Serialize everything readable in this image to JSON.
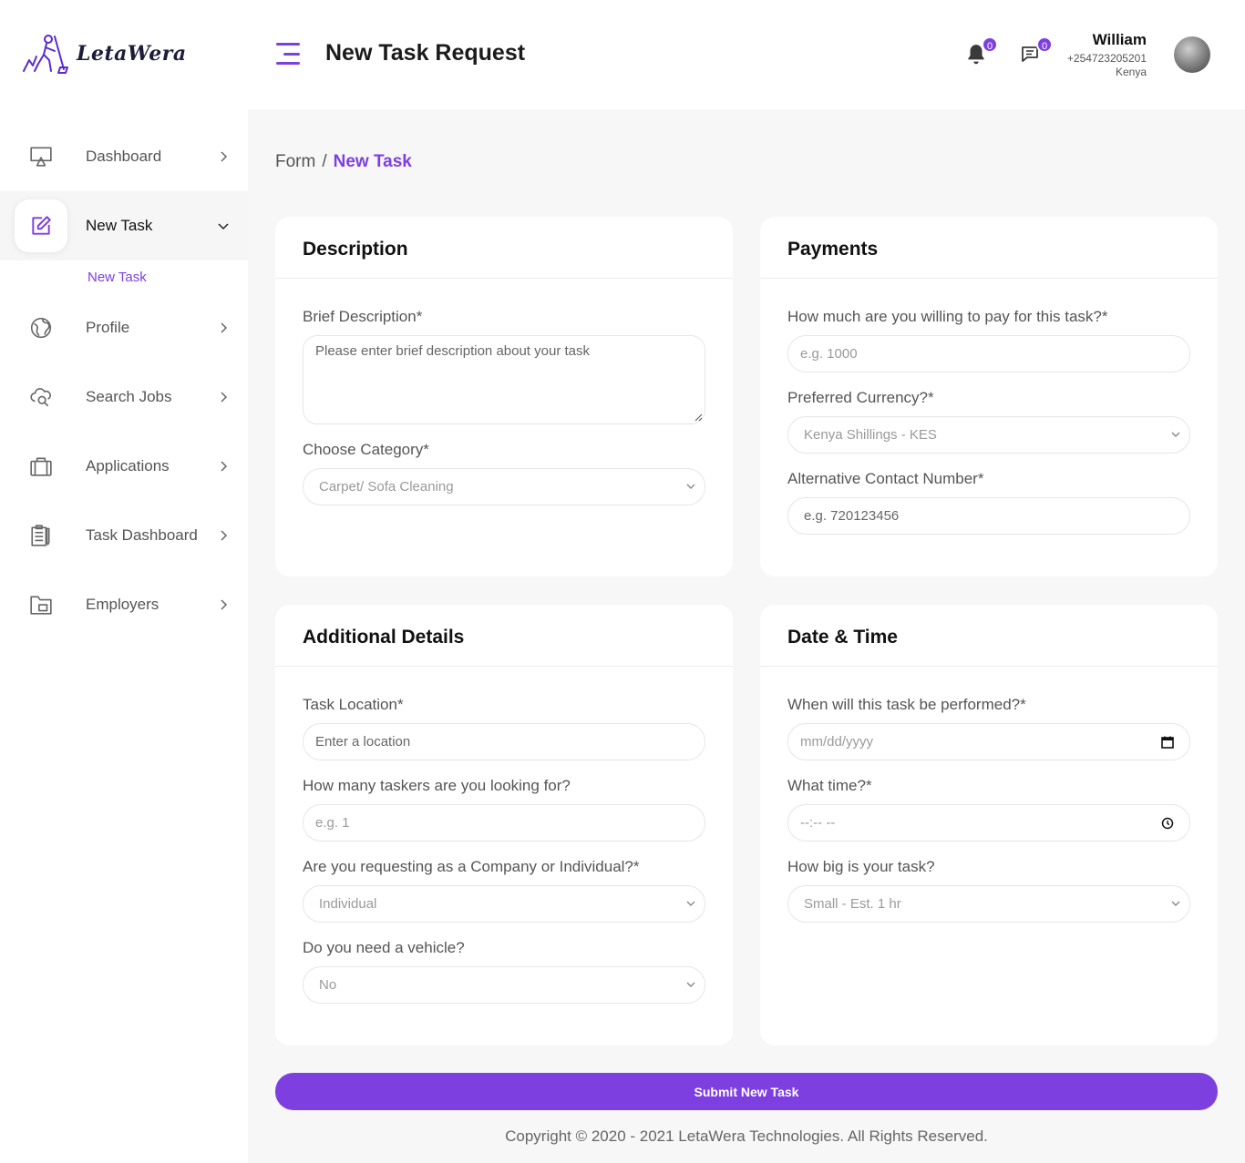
{
  "brand": {
    "name": "LetaWera"
  },
  "header": {
    "title": "New Task Request",
    "notifications_count": "0",
    "messages_count": "0",
    "user": {
      "name": "William",
      "phone": "+254723205201",
      "country": "Kenya"
    }
  },
  "sidebar": {
    "items": [
      {
        "label": "Dashboard",
        "icon": "monitor-icon"
      },
      {
        "label": "New Task",
        "icon": "edit-icon"
      },
      {
        "label": "Profile",
        "icon": "globe-icon"
      },
      {
        "label": "Search Jobs",
        "icon": "cloud-search-icon"
      },
      {
        "label": "Applications",
        "icon": "briefcase-icon"
      },
      {
        "label": "Task Dashboard",
        "icon": "clipboard-icon"
      },
      {
        "label": "Employers",
        "icon": "folder-icon"
      }
    ],
    "sub_item": "New Task"
  },
  "breadcrumb": {
    "parent": "Form",
    "separator": "/",
    "current": "New Task"
  },
  "description": {
    "title": "Description",
    "brief_label": "Brief Description*",
    "brief_placeholder": "Please enter brief description about your task",
    "category_label": "Choose Category*",
    "category_value": "Carpet/ Sofa Cleaning"
  },
  "payments": {
    "title": "Payments",
    "amount_label": "How much are you willing to pay for this task?*",
    "amount_placeholder": "e.g. 1000",
    "currency_label": "Preferred Currency?*",
    "currency_value": "Kenya Shillings - KES",
    "alt_contact_label": "Alternative Contact Number*",
    "alt_contact_placeholder": "e.g. 720123456"
  },
  "additional": {
    "title": "Additional Details",
    "location_label": "Task Location*",
    "location_placeholder": "Enter a location",
    "taskers_label": "How many taskers are you looking for?",
    "taskers_placeholder": "e.g. 1",
    "requester_label": "Are you requesting as a Company or Individual?*",
    "requester_value": "Individual",
    "vehicle_label": "Do you need a vehicle?",
    "vehicle_value": "No"
  },
  "datetime": {
    "title": "Date & Time",
    "date_label": "When will this task be performed?*",
    "date_placeholder": "mm/dd/yyyy",
    "time_label": "What time?*",
    "time_placeholder": "--:-- --",
    "size_label": "How big is your task?",
    "size_value": "Small - Est. 1 hr"
  },
  "submit_label": "Submit New Task",
  "footer": "Copyright © 2020 - 2021 LetaWera Technologies. All Rights Reserved.",
  "colors": {
    "accent": "#7e3fe0",
    "background": "#f7f7f7"
  }
}
